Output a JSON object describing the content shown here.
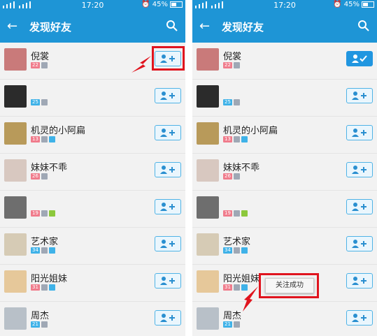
{
  "status_bar": {
    "time": "17:20",
    "battery": "45%"
  },
  "header": {
    "title": "发现好友"
  },
  "users": [
    {
      "name": "倪裳",
      "age": "22",
      "gender": "f",
      "tags": [
        "gray"
      ]
    },
    {
      "name": "",
      "age": "25",
      "gender": "m",
      "tags": [
        "gray"
      ]
    },
    {
      "name": "机灵的小阿扁",
      "age": "13",
      "gender": "f",
      "tags": [
        "gray",
        "blue"
      ]
    },
    {
      "name": "妹妹不乖",
      "age": "26",
      "gender": "f",
      "tags": [
        "gray"
      ]
    },
    {
      "name": "",
      "age": "19",
      "gender": "f",
      "tags": [
        "gray",
        "green"
      ]
    },
    {
      "name": "艺术家",
      "age": "34",
      "gender": "m",
      "tags": [
        "gray",
        "blue"
      ]
    },
    {
      "name": "阳光姐妹",
      "age": "31",
      "gender": "f",
      "tags": [
        "gray",
        "blue"
      ]
    },
    {
      "name": "周杰",
      "age": "21",
      "gender": "m",
      "tags": [
        "gray"
      ]
    }
  ],
  "toast": {
    "text": "关注成功"
  },
  "colors": {
    "brand": "#1e95d6",
    "highlight": "#e0141e"
  }
}
